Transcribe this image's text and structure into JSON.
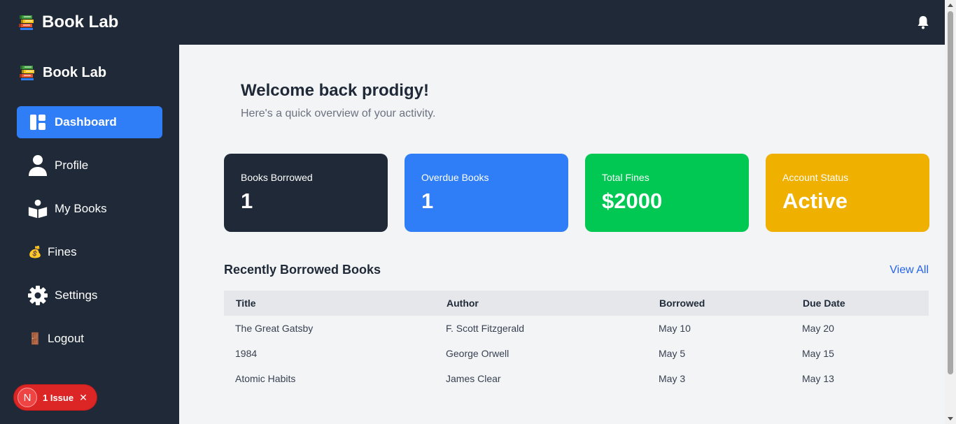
{
  "app": {
    "title": "Book Lab",
    "logo_icon": "books-stack-icon"
  },
  "header": {
    "notification_icon": "bell-icon"
  },
  "sidebar": {
    "title": "Book Lab",
    "items": [
      {
        "label": "Dashboard",
        "icon": "dashboard-icon",
        "active": true
      },
      {
        "label": "Profile",
        "icon": "user-icon"
      },
      {
        "label": "My Books",
        "icon": "reader-icon"
      },
      {
        "label": "Fines",
        "icon": "money-bag-icon"
      },
      {
        "label": "Settings",
        "icon": "gear-icon"
      },
      {
        "label": "Logout",
        "icon": "door-icon"
      }
    ]
  },
  "issue_badge": {
    "letter": "N",
    "label": "1 Issue",
    "close": "✕"
  },
  "welcome": {
    "title": "Welcome back prodigy!",
    "subtitle": "Here's a quick overview of your activity."
  },
  "stats": [
    {
      "label": "Books Borrowed",
      "value": "1",
      "color": "#1f2937"
    },
    {
      "label": "Overdue Books",
      "value": "1",
      "color": "#2f7ef7"
    },
    {
      "label": "Total Fines",
      "value": "$2000",
      "color": "#00c853"
    },
    {
      "label": "Account Status",
      "value": "Active",
      "color": "#f0b000"
    }
  ],
  "recent": {
    "title": "Recently Borrowed Books",
    "view_all": "View All",
    "columns": [
      "Title",
      "Author",
      "Borrowed",
      "Due Date"
    ],
    "rows": [
      [
        "The Great Gatsby",
        "F. Scott Fitzgerald",
        "May 10",
        "May 20"
      ],
      [
        "1984",
        "George Orwell",
        "May 5",
        "May 15"
      ],
      [
        "Atomic Habits",
        "James Clear",
        "May 3",
        "May 13"
      ]
    ]
  }
}
